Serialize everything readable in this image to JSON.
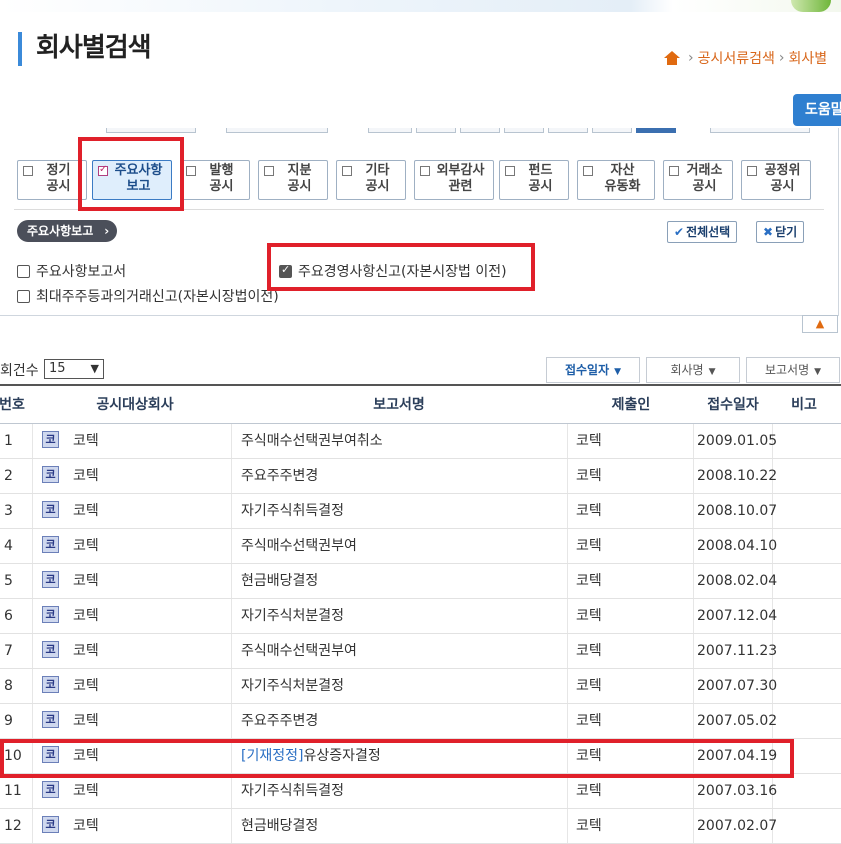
{
  "page": {
    "title": "회사별검색"
  },
  "breadcrumb": {
    "items": [
      "공시서류검색",
      "회사별"
    ]
  },
  "help_button": {
    "label": "도움말"
  },
  "categories": [
    {
      "label": "정기\n공시",
      "active": false
    },
    {
      "label": "주요사항\n보고",
      "active": true
    },
    {
      "label": "발행\n공시",
      "active": false
    },
    {
      "label": "지분\n공시",
      "active": false
    },
    {
      "label": "기타\n공시",
      "active": false
    },
    {
      "label": "외부감사\n관련",
      "active": false
    },
    {
      "label": "펀드\n공시",
      "active": false
    },
    {
      "label": "자산\n유동화",
      "active": false
    },
    {
      "label": "거래소\n공시",
      "active": false
    },
    {
      "label": "공정위\n공시",
      "active": false
    }
  ],
  "section": {
    "tag": "주요사항보고",
    "select_all": "전체선택",
    "close": "닫기",
    "options": [
      {
        "label": "주요사항보고서",
        "checked": false
      },
      {
        "label": "주요경영사항신고(자본시장법 이전)",
        "checked": true
      },
      {
        "label": "최대주주등과의거래신고(자본시장법이전)",
        "checked": false
      }
    ]
  },
  "results": {
    "count_label": "회건수",
    "count_value": "15",
    "sort_buttons": [
      "접수일자",
      "회사명",
      "보고서명"
    ],
    "headers": [
      "번호",
      "공시대상회사",
      "보고서명",
      "제출인",
      "접수일자",
      "비고"
    ],
    "company_icon": "코",
    "rows": [
      {
        "no": "1",
        "company": "코텍",
        "tag": "",
        "report": "주식매수선택권부여취소",
        "submitter": "코텍",
        "date": "2009.01.05"
      },
      {
        "no": "2",
        "company": "코텍",
        "tag": "",
        "report": "주요주주변경",
        "submitter": "코텍",
        "date": "2008.10.22"
      },
      {
        "no": "3",
        "company": "코텍",
        "tag": "",
        "report": "자기주식취득결정",
        "submitter": "코텍",
        "date": "2008.10.07"
      },
      {
        "no": "4",
        "company": "코텍",
        "tag": "",
        "report": "주식매수선택권부여",
        "submitter": "코텍",
        "date": "2008.04.10"
      },
      {
        "no": "5",
        "company": "코텍",
        "tag": "",
        "report": "현금배당결정",
        "submitter": "코텍",
        "date": "2008.02.04"
      },
      {
        "no": "6",
        "company": "코텍",
        "tag": "",
        "report": "자기주식처분결정",
        "submitter": "코텍",
        "date": "2007.12.04"
      },
      {
        "no": "7",
        "company": "코텍",
        "tag": "",
        "report": "주식매수선택권부여",
        "submitter": "코텍",
        "date": "2007.11.23"
      },
      {
        "no": "8",
        "company": "코텍",
        "tag": "",
        "report": "자기주식처분결정",
        "submitter": "코텍",
        "date": "2007.07.30"
      },
      {
        "no": "9",
        "company": "코텍",
        "tag": "",
        "report": "주요주주변경",
        "submitter": "코텍",
        "date": "2007.05.02"
      },
      {
        "no": "10",
        "company": "코텍",
        "tag": "[기재정정]",
        "report": "유상증자결정",
        "submitter": "코텍",
        "date": "2007.04.19"
      },
      {
        "no": "11",
        "company": "코텍",
        "tag": "",
        "report": "자기주식취득결정",
        "submitter": "코텍",
        "date": "2007.03.16"
      },
      {
        "no": "12",
        "company": "코텍",
        "tag": "",
        "report": "현금배당결정",
        "submitter": "코텍",
        "date": "2007.02.07"
      }
    ]
  },
  "colors": {
    "accent": "#3b8ad9",
    "highlight": "#e0202a",
    "breadcrumb": "#d8661a"
  }
}
